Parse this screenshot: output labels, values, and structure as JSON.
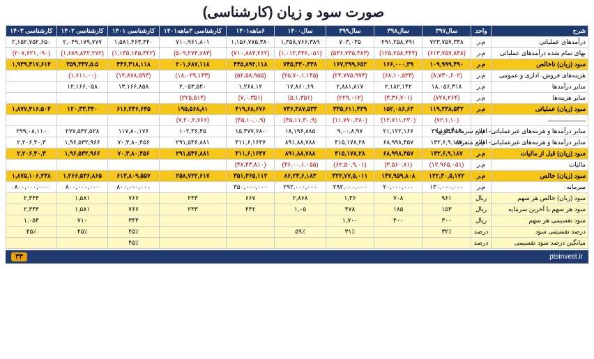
{
  "title": "صورت سود و زیان (کارشناسی)",
  "columns": [
    {
      "label": "شرح",
      "key": "label"
    },
    {
      "label": "واحد",
      "key": "unit"
    },
    {
      "label": "سال۳۹۷",
      "key": "y397"
    },
    {
      "label": "سال۳۹۸",
      "key": "y398"
    },
    {
      "label": "سال۳۹۹",
      "key": "y399"
    },
    {
      "label": "سال۱۴۰۰",
      "key": "y1400"
    },
    {
      "label": "۶ماهه۱۴۰۱",
      "key": "y1401h"
    },
    {
      "label": "کارشناسی ۳ماهه۱۴۰۱",
      "key": "y1401q"
    },
    {
      "label": "کارشناسی ۱۴۰۱",
      "key": "k1401"
    },
    {
      "label": "کارشناسی ۱۴۰۲",
      "key": "k1402"
    },
    {
      "label": "کارشناسی ۱۴۰۳",
      "key": "k1403"
    }
  ],
  "rows": [
    {
      "type": "normal",
      "label": "درآمدهای عملیاتی",
      "unit": "م.ر",
      "y397": "۷۲۳,۷۵۷,۳۳۸",
      "y398": "۲۹۱,۲۵۸,۷۹۱",
      "y399": "۷۰۳,۰۳۵",
      "y1400": "۱,۳۵۸,۷۶۶,۳۸۹",
      "y1401h": "۱,۱۵۶,۷۷۵,۳۸۰",
      "y1401q": "۷۱۰,۹۶۱,۸۰۱",
      "k1401": "۱,۵۸۱,۴۶۳,۴۴۰",
      "k1402": "۲,۰۴۹,۱۷۹,۷۷۷",
      "k1403": "۲,۱۵۲,۷۵۲,۶۵۰"
    },
    {
      "type": "normal",
      "label": "بهای تمام شده درآمدهای عملیاتی",
      "unit": "م.ر",
      "y397": "(۶۱۳,۷۵۷,۸۴۸)",
      "y398": "(۱۲۵,۲۵۸,۳۴۴)",
      "y399": "(۵۳۶,۷۳۵,۳۸۳)",
      "y1400": "(۱,۰۱۲,۴۳۶,۰۵۱)",
      "y1401h": "(۷۱۰,۸۸۳,۲۶۲)",
      "y1401q": "(۵۰۹,۲۷۴,۶۸۳)",
      "k1401": "(۱,۱۳۵,۱۴۵,۳۲۲)",
      "k1402": "(۱,۶۸۹,۸۴۲,۲۷۲)",
      "k1403": "(۲۰۷,۶۲۱,۰۹۰)"
    },
    {
      "type": "yellow",
      "label": "سود (زیان) ناخالص",
      "unit": "م.ر",
      "y397": "۱۰۹,۹۹۹,۴۹۰",
      "y398": "۱۶۶,۰۰۰,۳۹",
      "y399": "۱۶۷,۲۹۹,۶۵۲",
      "y1400": "۷۴۵,۳۳۰,۳۳۸",
      "y1401h": "۴۴۵,۸۹۲,۱۱۸",
      "y1401q": "۲۰۱,۶۸۷,۱۱۸",
      "k1401": "۴۴۶,۳۱۸,۱۱۸",
      "k1402": "۳۵۹,۳۳۷,۵.۵",
      "k1403": "۱,۹۴۹,۳۱۷,۶۱۴"
    },
    {
      "type": "normal",
      "label": "هزینه‌های فروش، اداری و عمومی",
      "unit": "م.ر",
      "y397": "(۸,۷۳۰,۶۰۲)",
      "y398": "(۶۸,۱۰,۵۳۳)",
      "y399": "(۲۴,۷۷۵,۹۷۳)",
      "y1400": "(۲۵,۷۰,۱,۱۴۵)",
      "y1401h": "(۵۲,۵۸,۹۵۵)",
      "y1401q": "(۱۸,۰۲۹,۱۳۳)",
      "k1401": "(۱۴,۸۷۸,۵۹۳)",
      "k1402": "(۱,۶۱۱,۰۰)",
      "k1403": ""
    },
    {
      "type": "normal",
      "label": "سایر درآمدها",
      "unit": "م.ر",
      "y397": "۱۸,۰۵۶,۳۱۸",
      "y398": "۲,۱۸۲,۱۴۲",
      "y399": "۲,۸۸۱,۸۱۷",
      "y1400": "۱۷,۸۶۰,۱۹",
      "y1401h": "۱,۲۶۸,۱۲",
      "y1401q": "۲,۰۵۳,۵۲۰",
      "k1401": "۱۳,۱۶۶,۸۵۸",
      "k1402": "۱۲,۱۶۶,۰۵۸",
      "k1403": ""
    },
    {
      "type": "normal",
      "label": "سایر هزینه‌ها",
      "unit": "م.ر",
      "y397": "(۷۲۸,۲۶۴)",
      "y398": "(۳,۳۶,۷۰۱)",
      "y399": "(۲۲۹,۰۱۲)",
      "y1400": "(۵,۱,۳۵۱)",
      "y1401h": "(۷,۰,۳۵۱)",
      "y1401q": "(۲۲۵,۵۱۴)",
      "k1401": "",
      "k1402": "",
      "k1403": ""
    },
    {
      "type": "yellow",
      "label": "سود (زیان) عملیاتی",
      "unit": "م.ر",
      "y397": "۱۱۹,۲۳۸,۵۳۲",
      "y398": "۱۵۲,۰۸۶,۶۳",
      "y399": "۳۳۵,۶۱۱,۴۳۹",
      "y1400": "۷۳۶,۳۸۷,۵۳۳",
      "y1401h": "۴۱۹,۶۸,۶۷۶",
      "y1401q": "۱۹۵,۵۶۸,۸۱",
      "k1401": "۶۱۶,۲۳۶,۶۴۵",
      "k1402": "۱۲۰,۳۳,۳۴۰",
      "k1403": "۱,۸۷۷,۴۱۶,۵۰۴"
    },
    {
      "type": "normal",
      "label": "——————",
      "unit": "",
      "y397": "(۷۲,۱,۱۰)",
      "y398": "(۱۲,۷۱۱,۲۳۰)",
      "y399": "(۱۱,۷۷۰,۳۸۰)",
      "y1400": "(۳۵,۱۱,۳۰,۹)",
      "y1401h": "(۳۵,۱۰,۰,۹)",
      "y1401q": "(۷,۲۰,۲,۷۶۶)",
      "k1401": "",
      "k1402": "",
      "k1403": ""
    },
    {
      "type": "normal",
      "label": "سایر درآمدها و هزینه‌های غیرعملیاتی- اقلام سرمایه‌گذاریها",
      "unit": "م.ر",
      "y397": "۳۲,۱۸۳,۳۱۹",
      "y398": "۲۱,۱۲۲,۱۶۶",
      "y399": "۹,۰۰,۸,۹۷",
      "y1400": "۱۸,۱۹۶,۸۸۵",
      "y1401h": "۱۵,۳۷۷,۶۸۰",
      "y1401q": "۱۰۲,۳۶,۴۵",
      "k1401": "۱۱۷,۸۰,۱۷۶",
      "k1402": "۲۷۷,۵۴۲,۵۲۸",
      "k1403": "۲۹۹,۰۸,۱۱۰"
    },
    {
      "type": "normal",
      "label": "سایر درآمدها و هزینه‌های غیرعملیاتی- اقلام متفرقه",
      "unit": "م.ر",
      "y397": "۱۳۲,۶,۹,۱۸۷",
      "y398": "۶۸,۹۹۸,۴۵۷",
      "y399": "۴۱۵,۱۷۸,۲۸",
      "y1400": "۸۹۱,۸۸,۷۸۸",
      "y1401h": "۴۱۱,۶,۱۶۴۷",
      "y1401q": "۲۹۱,۵۳۶,۸۸۱",
      "k1401": "۷۰,۳,۸۰,۴۵۶",
      "k1402": "۱,۹۶,۵۳۲,۹۶۶",
      "k1403": "۲,۲۰۶,۴۰,۳"
    },
    {
      "type": "yellow",
      "label": "سود (زیان) قبل از مالیات",
      "unit": "م.ر",
      "y397": "۱۳۲,۶,۹,۱۸۷",
      "y398": "۶۸,۹۹۸,۴۵۷",
      "y399": "۴۱۵,۱۷۸,۲۸",
      "y1400": "۸۹۱,۸۸,۷۸۸",
      "y1401h": "۴۱۱,۶,۱۶۴۷",
      "y1401q": "۲۹۱,۵۳۶,۸۸۱",
      "k1401": "۷۰,۳,۸۰,۴۵۶",
      "k1402": "۱,۹۶,۵۳۲,۹۶۶",
      "k1403": "۲,۲۰۶,۴۰,۳"
    },
    {
      "type": "normal",
      "label": "مالیات",
      "unit": "م.ر",
      "y397": "(۱۲,۹۶۵,۰۵۱)",
      "y398": "(۳,۵۶۰,۸۱)",
      "y399": "(۶۲,۵۰,۹,۰۱)",
      "y1400": "(۴۶,۰۰,۱,۰۵۵)",
      "y1401h": "(۳۸,۴۳,۸۱۰)",
      "y1401q": "",
      "k1401": "",
      "k1402": "",
      "k1403": ""
    },
    {
      "type": "yellow",
      "label": "سود (زیان) خالص",
      "unit": "م.ر",
      "y397": "۱۲۲,۳۰,۵,۱۷۲",
      "y398": "۱۴۷,۹۵۹,۸۰۸",
      "y399": "۳۲۲,۷۷,۵,۰۱۱",
      "y1400": "۸۶,۲۳,۶,۱۸۳",
      "y1401h": "۳۵۱,۳۶۵,۱۱۲",
      "y1401q": "۲۵۸,۷۲۲,۶۱۷",
      "k1401": "۶۱۳,۸۰۹,۵۵۷",
      "k1402": "۱,۲۶۶,۵۳۶,۸۶۵",
      "k1403": "۱,۸۷۵,۱۰۶,۲۳۸"
    },
    {
      "type": "normal",
      "label": "سرمایه",
      "unit": "م.ر",
      "y397": "۱۳۰,۰۰۰,۰۰۰",
      "y398": "۲۰,۰۰۰,۰۰۰",
      "y399": "۲۹۲,۰۰۰,۰۰۰",
      "y1400": "۲۹۲,۰۰۰,۰۰۰",
      "y1401h": "۳۵۰,۰۰۰,۰۰۰",
      "y1401q": "",
      "k1401": "۸۰۰,۰۰۰,۰۰۰",
      "k1402": "۸۰۰,۰۰۰,۰۰۰",
      "k1403": "۸۰۰,۰۰۰,۰۰۰"
    },
    {
      "type": "light-yellow",
      "label": "سود (زیان) خالص هر سهم",
      "unit": "ریال",
      "y397": "۹۶۱",
      "y398": "۷۰۸",
      "y399": "۱,۳۶",
      "y1400": "۲,۸۶۸",
      "y1401h": "۶۶۷",
      "y1401q": "۲۳۳",
      "k1401": "۷۶۶",
      "k1402": "۱,۵۸۱",
      "k1403": "۲,۳۴۴"
    },
    {
      "type": "light-yellow",
      "label": "سود هر سهم با آخرین سرمایه",
      "unit": "ریال",
      "y397": "۱۵۳",
      "y398": "۱۸۵",
      "y399": "۴۷۸",
      "y1400": "۱,۰۵",
      "y1401h": "۴۴۲",
      "y1401q": "۲۳۳",
      "k1401": "۷۶۶",
      "k1402": "۱,۵۸۱",
      "k1403": "۲,۳۴۴"
    },
    {
      "type": "light-yellow",
      "label": "سود تقسیمی هر سهم",
      "unit": "ریال",
      "y397": "۳۰۰",
      "y398": "۴۰۰",
      "y399": "۱,۷۰۰",
      "y1400": "",
      "y1401h": "",
      "y1401q": "",
      "k1401": "۳۴۴",
      "k1402": "۷۱۰",
      "k1403": "۱,۰۵۴"
    },
    {
      "type": "light-yellow",
      "label": "درصد تقسیمی سود",
      "unit": "درصد",
      "y397": "۳۲٪",
      "y398": "",
      "y399": "۳۱٪",
      "y1400": "۵۹٪",
      "y1401h": "",
      "y1401q": "",
      "k1401": "۴۵٪",
      "k1402": "۴۵٪",
      "k1403": "۴۵٪"
    },
    {
      "type": "light-yellow",
      "label": "میانگین درصد سود تقسیمی",
      "unit": "درصد",
      "y397": "",
      "y398": "",
      "y399": "",
      "y1400": "",
      "y1401h": "",
      "y1401q": "",
      "k1401": "۴۵٪",
      "k1402": "",
      "k1403": ""
    }
  ],
  "footer": {
    "site": "ptsinvest.ir",
    "page": "۳۳"
  }
}
